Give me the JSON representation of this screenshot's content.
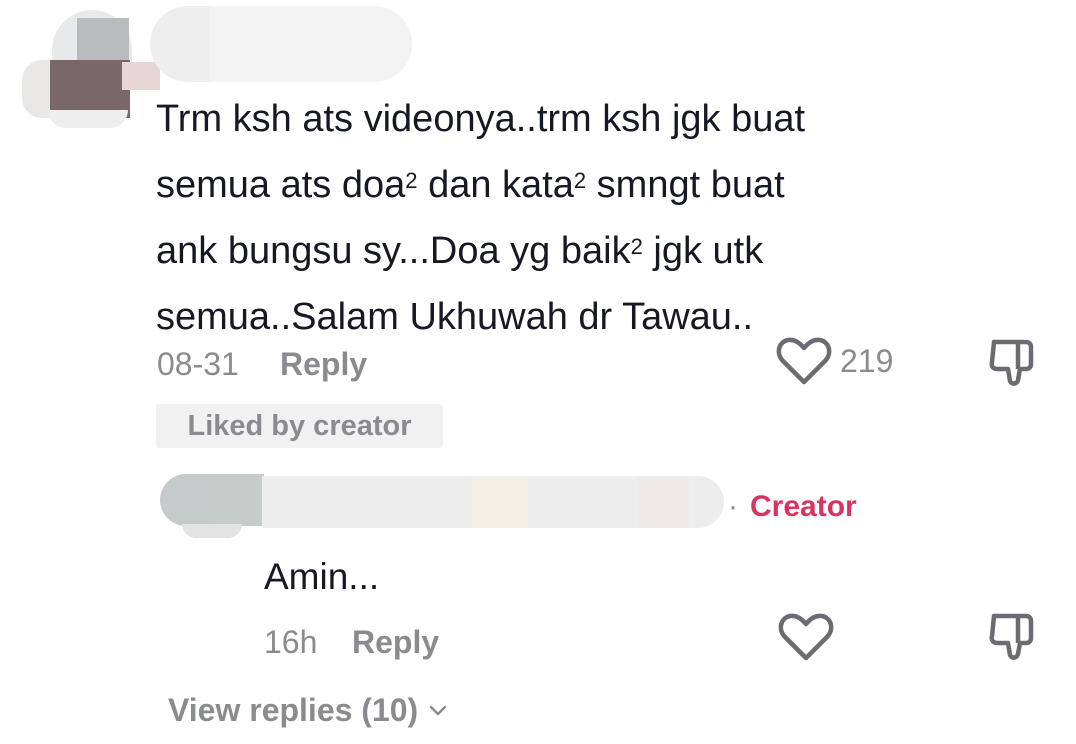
{
  "comment": {
    "text_parts": {
      "l1": "Trm ksh ats videonya..trm ksh jgk buat",
      "l2a": "semua ats doa",
      "sup1": "2",
      "l2b": " dan kata",
      "sup2": "2",
      "l2c": " smngt buat",
      "l3a": "ank bungsu sy...Doa yg baik",
      "sup3": "2",
      "l3b": " jgk utk",
      "l4": "semua..Salam Ukhuwah dr Tawau.."
    },
    "time": "08-31",
    "reply_label": "Reply",
    "like_count": "219",
    "liked_by_label": "Liked by creator"
  },
  "reply": {
    "separator": "·",
    "creator_label": "Creator",
    "text": "Amin...",
    "time": "16h",
    "reply_label": "Reply"
  },
  "view_replies": {
    "label": "View replies (10)"
  },
  "colors": {
    "text": "#161823",
    "muted": "#8a8b91",
    "creator": "#d8345f",
    "badge_bg": "#f1f1f2"
  },
  "icons": {
    "like": "heart-outline-icon",
    "dislike": "thumbs-down-icon",
    "expand": "chevron-down-icon"
  }
}
